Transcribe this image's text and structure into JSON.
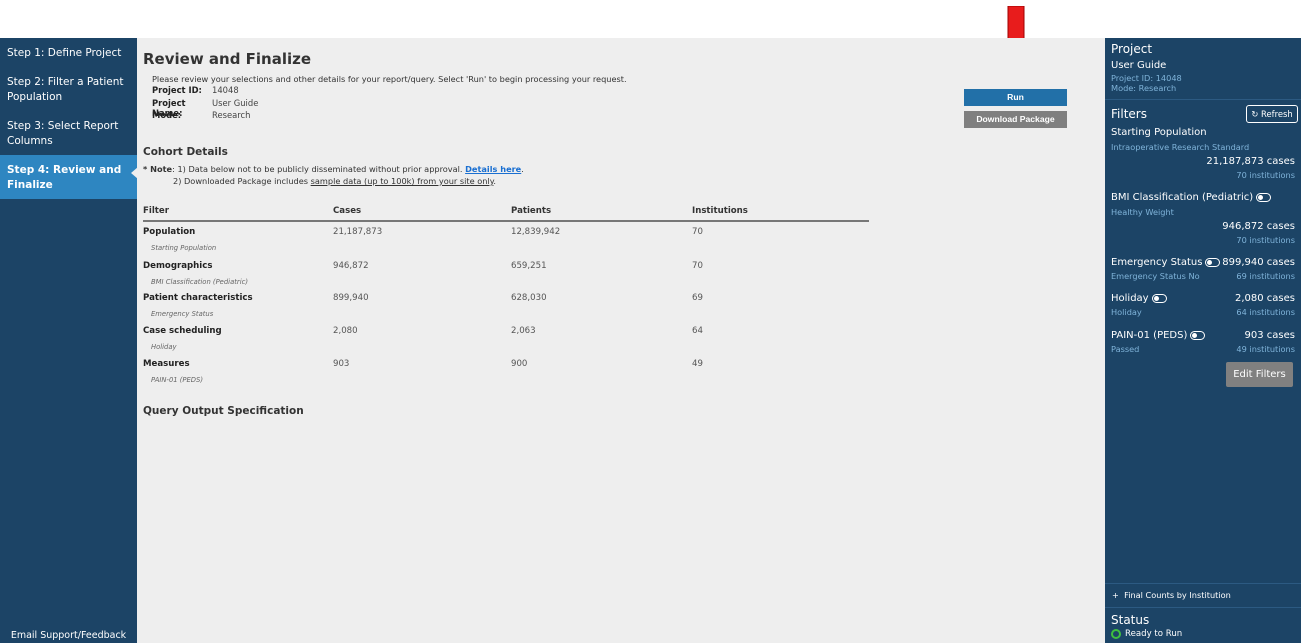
{
  "nav": {
    "items": [
      {
        "label": "Step 1: Define Project",
        "active": false
      },
      {
        "label": "Step 2: Filter a Patient Population",
        "active": false
      },
      {
        "label": "Step 3: Select Report Columns",
        "active": false
      },
      {
        "label": "Step 4: Review and Finalize",
        "active": true
      }
    ],
    "footer": "Email Support/Feedback"
  },
  "main": {
    "title": "Review and Finalize",
    "intro": "Please review your selections and other details for your report/query. Select 'Run' to begin processing your request.",
    "meta": [
      {
        "label": "Project ID:",
        "value": "14048"
      },
      {
        "label": "Project Name:",
        "value": "User Guide"
      },
      {
        "label": "Mode:",
        "value": "Research"
      }
    ],
    "cohort_title": "Cohort Details",
    "note": {
      "prefix": "* Note",
      "line1": ": 1) Data below not to be publicly disseminated without prior approval. ",
      "link": "Details here",
      "line1_end": ".",
      "line2_a": "2) Downloaded Package includes ",
      "line2_u": "sample data (up to 100k) from your site only",
      "line2_b": "."
    },
    "table": {
      "headers": [
        "Filter",
        "Cases",
        "Patients",
        "Institutions"
      ],
      "rows": [
        {
          "name": "Population",
          "sub": "Starting Population",
          "cases": "21,187,873",
          "patients": "12,839,942",
          "institutions": "70"
        },
        {
          "name": "Demographics",
          "sub": "BMI Classification (Pediatric)",
          "cases": "946,872",
          "patients": "659,251",
          "institutions": "70"
        },
        {
          "name": "Patient characteristics",
          "sub": "Emergency Status",
          "cases": "899,940",
          "patients": "628,030",
          "institutions": "69"
        },
        {
          "name": "Case scheduling",
          "sub": "Holiday",
          "cases": "2,080",
          "patients": "2,063",
          "institutions": "64"
        },
        {
          "name": "Measures",
          "sub": "PAIN-01 (PEDS)",
          "cases": "903",
          "patients": "900",
          "institutions": "49"
        }
      ]
    },
    "output_title": "Query Output Specification",
    "run_label": "Run",
    "download_label": "Download Package"
  },
  "right": {
    "project_title": "Project",
    "project_name": "User Guide",
    "project_id": "Project ID: 14048",
    "project_mode": "Mode: Research",
    "filters_title": "Filters",
    "refresh_label": "Refresh",
    "starting": {
      "title": "Starting Population",
      "sub": "Intraoperative Research Standard",
      "cases": "21,187,873 cases",
      "institutions": "70 institutions"
    },
    "bmi": {
      "title": "BMI Classification (Pediatric)",
      "sub": "Healthy Weight",
      "cases": "946,872 cases",
      "institutions": "70 institutions"
    },
    "emergency": {
      "title": "Emergency Status",
      "sub": "Emergency Status No",
      "cases": "899,940 cases",
      "institutions": "69 institutions"
    },
    "holiday": {
      "title": "Holiday",
      "sub": "Holiday",
      "cases": "2,080 cases",
      "institutions": "64 institutions"
    },
    "pain": {
      "title": "PAIN-01 (PEDS)",
      "sub": "Passed",
      "cases": "903 cases",
      "institutions": "49 institutions"
    },
    "edit_label": "Edit Filters",
    "final_counts": "Final Counts by Institution",
    "status_title": "Status",
    "status_value": "Ready to Run"
  },
  "colors": {
    "sidebar": "#1c4466",
    "active": "#2e86c1",
    "run": "#2270a8",
    "download": "#7f7f7f",
    "arrow": "#e81c1c",
    "ready": "#3fbf3f"
  }
}
